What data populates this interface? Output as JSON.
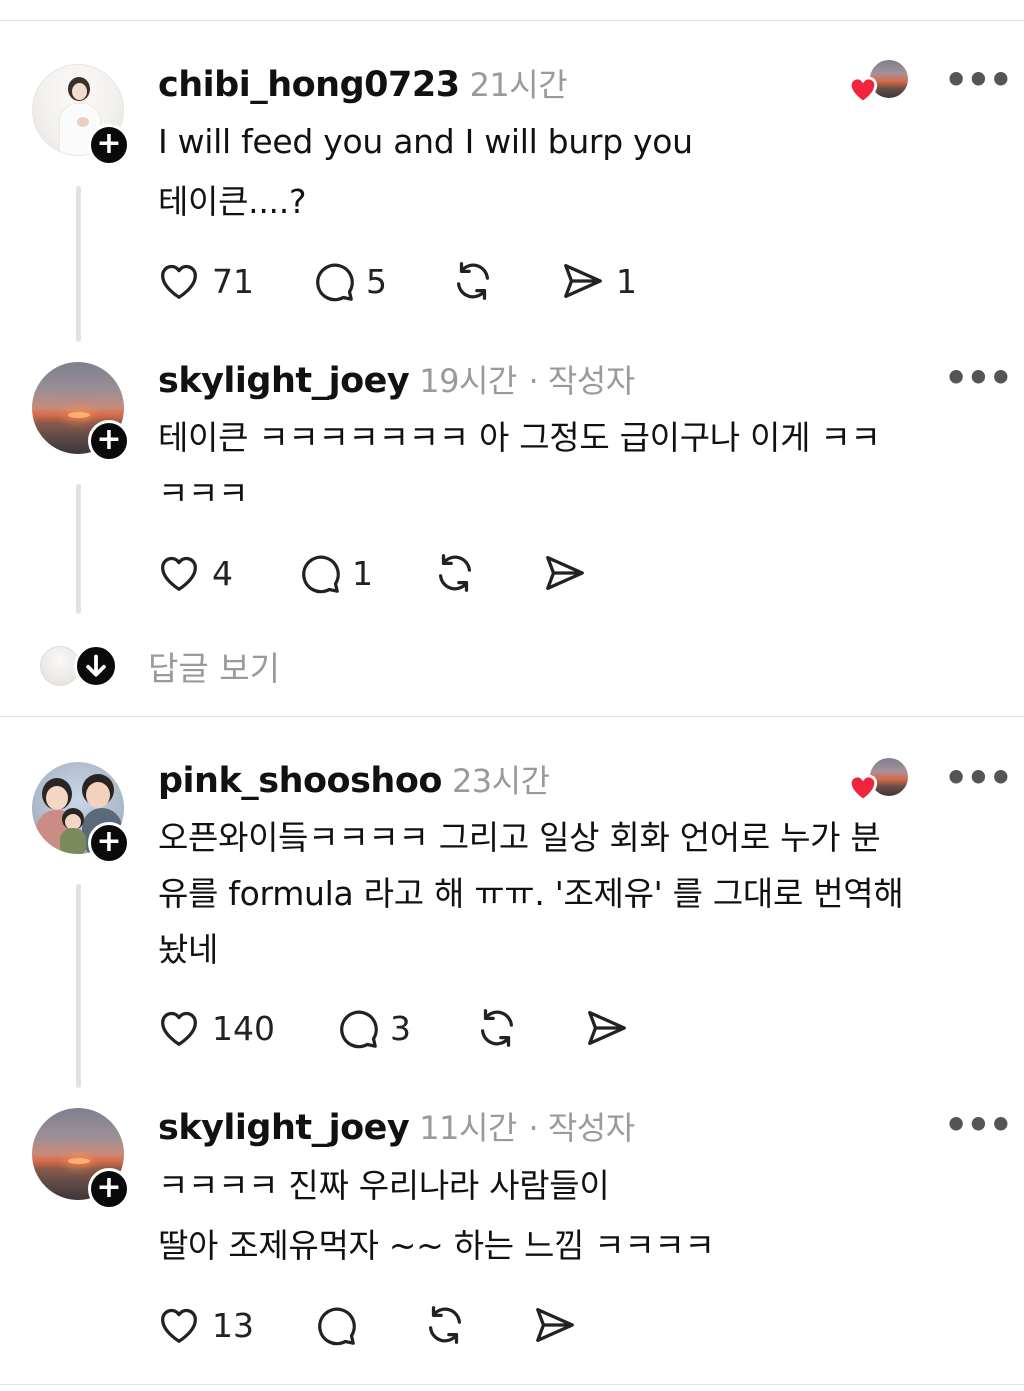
{
  "thread1": {
    "comment": {
      "username": "chibi_hong0723",
      "time": "21시간",
      "lines": [
        "I will feed you and I will burp you",
        "테이큰....?"
      ],
      "likes": "71",
      "replies": "5",
      "shares": "1"
    },
    "reply": {
      "username": "skylight_joey",
      "time": "19시간",
      "author_tag": "· 작성자",
      "lines": [
        "테이큰 ㅋㅋㅋㅋㅋㅋㅋ 아 그정도 급이구나 이게 ㅋㅋ",
        "ㅋㅋㅋ"
      ],
      "likes": "4",
      "replies": "1"
    },
    "view_replies_label": "답글 보기"
  },
  "thread2": {
    "comment": {
      "username": "pink_shooshoo",
      "time": "23시간",
      "lines": [
        "오픈와이듴ㅋㅋㅋㅋ 그리고 일상 회화 언어로 누가 분",
        "유를 formula 라고 해 ㅠㅠ. '조제유' 를 그대로 번역해",
        "놨네"
      ],
      "likes": "140",
      "replies": "3"
    },
    "reply": {
      "username": "skylight_joey",
      "time": "11시간",
      "author_tag": "· 작성자",
      "lines": [
        "ㅋㅋㅋㅋ 진짜 우리나라 사람들이",
        "딸아 조제유먹자 ~~ 하는 느낌 ㅋㅋㅋㅋ"
      ],
      "likes": "13"
    }
  },
  "icons": {
    "follow": "+",
    "more": "•••"
  },
  "colors": {
    "liked_heart": "#f0243c",
    "muted_text": "#9a9a9a",
    "badge": "#0a0a0a"
  }
}
